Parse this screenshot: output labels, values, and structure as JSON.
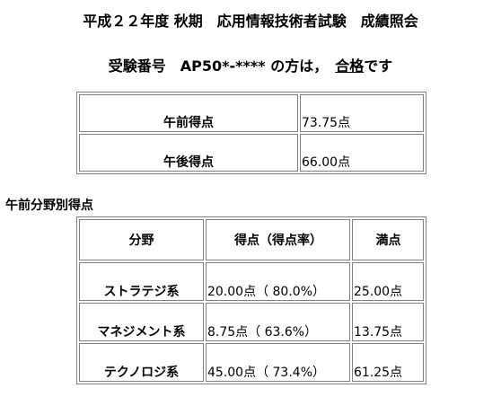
{
  "title": "平成２２年度 秋期　応用情報技術者試験　成績照会",
  "result": {
    "prefix": "受験番号　AP50*-**** の方は，",
    "verdict": "合格",
    "suffix": "です"
  },
  "summary": {
    "rows": [
      {
        "label": "午前得点",
        "value": "73.75点"
      },
      {
        "label": "午後得点",
        "value": "66.00点"
      }
    ]
  },
  "breakdown": {
    "heading": "午前分野別得点",
    "headers": {
      "field": "分野",
      "score": "得点（得点率）",
      "full": "満点"
    },
    "rows": [
      {
        "field": "ストラテジ系",
        "score": "20.00点（ 80.0%）",
        "full": "25.00点"
      },
      {
        "field": "マネジメント系",
        "score": "8.75点（ 63.6%）",
        "full": "13.75点"
      },
      {
        "field": "テクノロジ系",
        "score": "45.00点（ 73.4%）",
        "full": "61.25点"
      }
    ]
  }
}
